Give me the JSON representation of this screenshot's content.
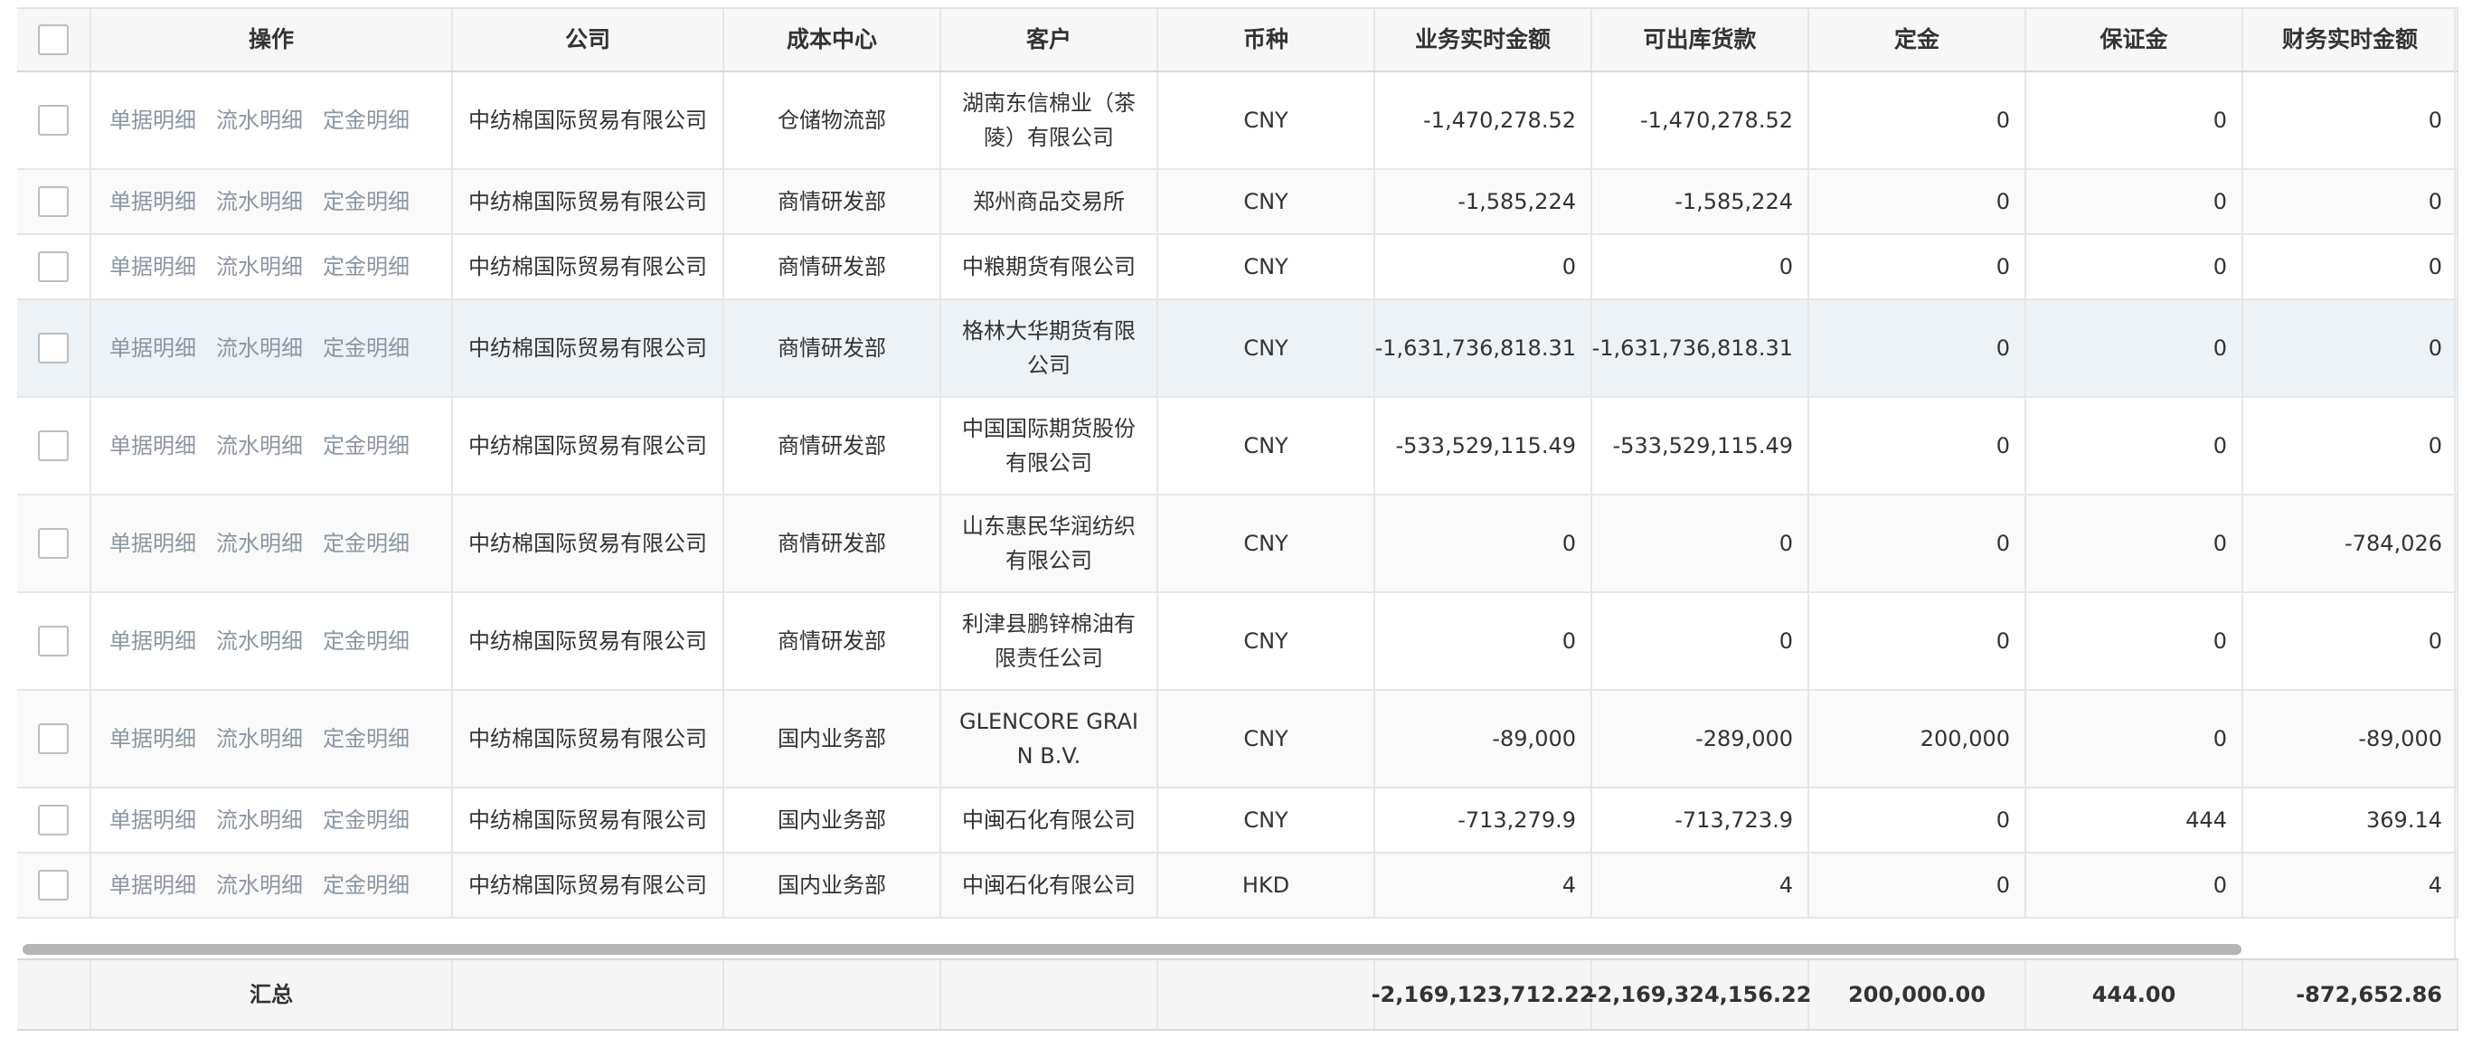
{
  "columns": [
    "",
    "操作",
    "公司",
    "成本中心",
    "客户",
    "币种",
    "业务实时金额",
    "可出库货款",
    "定金",
    "保证金",
    "财务实时金额"
  ],
  "actions": [
    "单据明细",
    "流水明细",
    "定金明细"
  ],
  "rows": [
    {
      "company": "中纺棉国际贸易有限公司",
      "cost_center": "仓储物流部",
      "customer": "湖南东信棉业（茶陵）有限公司",
      "currency": "CNY",
      "biz": "-1,470,278.52",
      "avail": "-1,470,278.52",
      "deposit": "0",
      "margin": "0",
      "finance": "0"
    },
    {
      "company": "中纺棉国际贸易有限公司",
      "cost_center": "商情研发部",
      "customer": "郑州商品交易所",
      "currency": "CNY",
      "biz": "-1,585,224",
      "avail": "-1,585,224",
      "deposit": "0",
      "margin": "0",
      "finance": "0"
    },
    {
      "company": "中纺棉国际贸易有限公司",
      "cost_center": "商情研发部",
      "customer": "中粮期货有限公司",
      "currency": "CNY",
      "biz": "0",
      "avail": "0",
      "deposit": "0",
      "margin": "0",
      "finance": "0"
    },
    {
      "company": "中纺棉国际贸易有限公司",
      "cost_center": "商情研发部",
      "customer": "格林大华期货有限公司",
      "currency": "CNY",
      "biz": "-1,631,736,818.31",
      "avail": "-1,631,736,818.31",
      "deposit": "0",
      "margin": "0",
      "finance": "0"
    },
    {
      "company": "中纺棉国际贸易有限公司",
      "cost_center": "商情研发部",
      "customer": "中国国际期货股份有限公司",
      "currency": "CNY",
      "biz": "-533,529,115.49",
      "avail": "-533,529,115.49",
      "deposit": "0",
      "margin": "0",
      "finance": "0"
    },
    {
      "company": "中纺棉国际贸易有限公司",
      "cost_center": "商情研发部",
      "customer": "山东惠民华润纺织有限公司",
      "currency": "CNY",
      "biz": "0",
      "avail": "0",
      "deposit": "0",
      "margin": "0",
      "finance": "-784,026"
    },
    {
      "company": "中纺棉国际贸易有限公司",
      "cost_center": "商情研发部",
      "customer": "利津县鹏锌棉油有限责任公司",
      "currency": "CNY",
      "biz": "0",
      "avail": "0",
      "deposit": "0",
      "margin": "0",
      "finance": "0"
    },
    {
      "company": "中纺棉国际贸易有限公司",
      "cost_center": "国内业务部",
      "customer": "GLENCORE GRAIN B.V.",
      "currency": "CNY",
      "biz": "-89,000",
      "avail": "-289,000",
      "deposit": "200,000",
      "margin": "0",
      "finance": "-89,000"
    },
    {
      "company": "中纺棉国际贸易有限公司",
      "cost_center": "国内业务部",
      "customer": "中闽石化有限公司",
      "currency": "CNY",
      "biz": "-713,279.9",
      "avail": "-713,723.9",
      "deposit": "0",
      "margin": "444",
      "finance": "369.14"
    },
    {
      "company": "中纺棉国际贸易有限公司",
      "cost_center": "国内业务部",
      "customer": "中闽石化有限公司",
      "currency": "HKD",
      "biz": "4",
      "avail": "4",
      "deposit": "0",
      "margin": "0",
      "finance": "4"
    }
  ],
  "total": {
    "label": "汇总",
    "biz": "-2,169,123,712.22",
    "avail": "-2,169,324,156.22",
    "deposit": "200,000.00",
    "margin": "444.00",
    "finance": "-872,652.86"
  },
  "colors": {
    "link": "#8b96a3",
    "header_bg": "#f7f7f7",
    "hover_row": "#edf2f6"
  }
}
